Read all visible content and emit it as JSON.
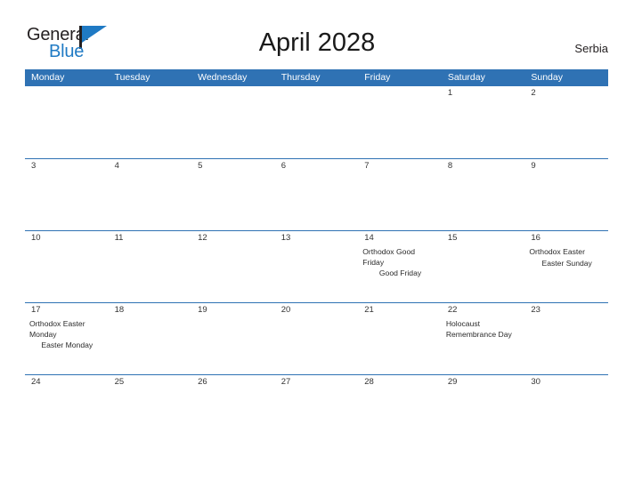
{
  "brand": {
    "word_one": "General",
    "word_two": "Blue",
    "flag_icon": "flag-icon",
    "color_text": "#231f20",
    "color_accent": "#1f7ac4"
  },
  "header": {
    "title": "April 2028",
    "region": "Serbia"
  },
  "theme": {
    "header_blue": "#2f72b4",
    "day_strip_gray": "#f1f1f1",
    "page_background": "#ffffff",
    "text_color": "#333333"
  },
  "calendar": {
    "weekdays": [
      "Monday",
      "Tuesday",
      "Wednesday",
      "Thursday",
      "Friday",
      "Saturday",
      "Sunday"
    ],
    "weeks": [
      [
        {
          "day": "",
          "events": []
        },
        {
          "day": "",
          "events": []
        },
        {
          "day": "",
          "events": []
        },
        {
          "day": "",
          "events": []
        },
        {
          "day": "",
          "events": []
        },
        {
          "day": "1",
          "events": []
        },
        {
          "day": "2",
          "events": []
        }
      ],
      [
        {
          "day": "3",
          "events": []
        },
        {
          "day": "4",
          "events": []
        },
        {
          "day": "5",
          "events": []
        },
        {
          "day": "6",
          "events": []
        },
        {
          "day": "7",
          "events": []
        },
        {
          "day": "8",
          "events": []
        },
        {
          "day": "9",
          "events": []
        }
      ],
      [
        {
          "day": "10",
          "events": []
        },
        {
          "day": "11",
          "events": []
        },
        {
          "day": "12",
          "events": []
        },
        {
          "day": "13",
          "events": []
        },
        {
          "day": "14",
          "events": [
            {
              "text": "Orthodox Good Friday",
              "align": "left"
            },
            {
              "text": "Good Friday",
              "align": "center"
            }
          ]
        },
        {
          "day": "15",
          "events": []
        },
        {
          "day": "16",
          "events": [
            {
              "text": "Orthodox Easter",
              "align": "left"
            },
            {
              "text": "Easter Sunday",
              "align": "center"
            }
          ]
        }
      ],
      [
        {
          "day": "17",
          "events": [
            {
              "text": "Orthodox Easter Monday",
              "align": "left"
            },
            {
              "text": "Easter Monday",
              "align": "center"
            }
          ]
        },
        {
          "day": "18",
          "events": []
        },
        {
          "day": "19",
          "events": []
        },
        {
          "day": "20",
          "events": []
        },
        {
          "day": "21",
          "events": []
        },
        {
          "day": "22",
          "events": [
            {
              "text": "Holocaust Remembrance Day",
              "align": "left"
            }
          ]
        },
        {
          "day": "23",
          "events": []
        }
      ],
      [
        {
          "day": "24",
          "events": []
        },
        {
          "day": "25",
          "events": []
        },
        {
          "day": "26",
          "events": []
        },
        {
          "day": "27",
          "events": []
        },
        {
          "day": "28",
          "events": []
        },
        {
          "day": "29",
          "events": []
        },
        {
          "day": "30",
          "events": []
        }
      ]
    ]
  }
}
